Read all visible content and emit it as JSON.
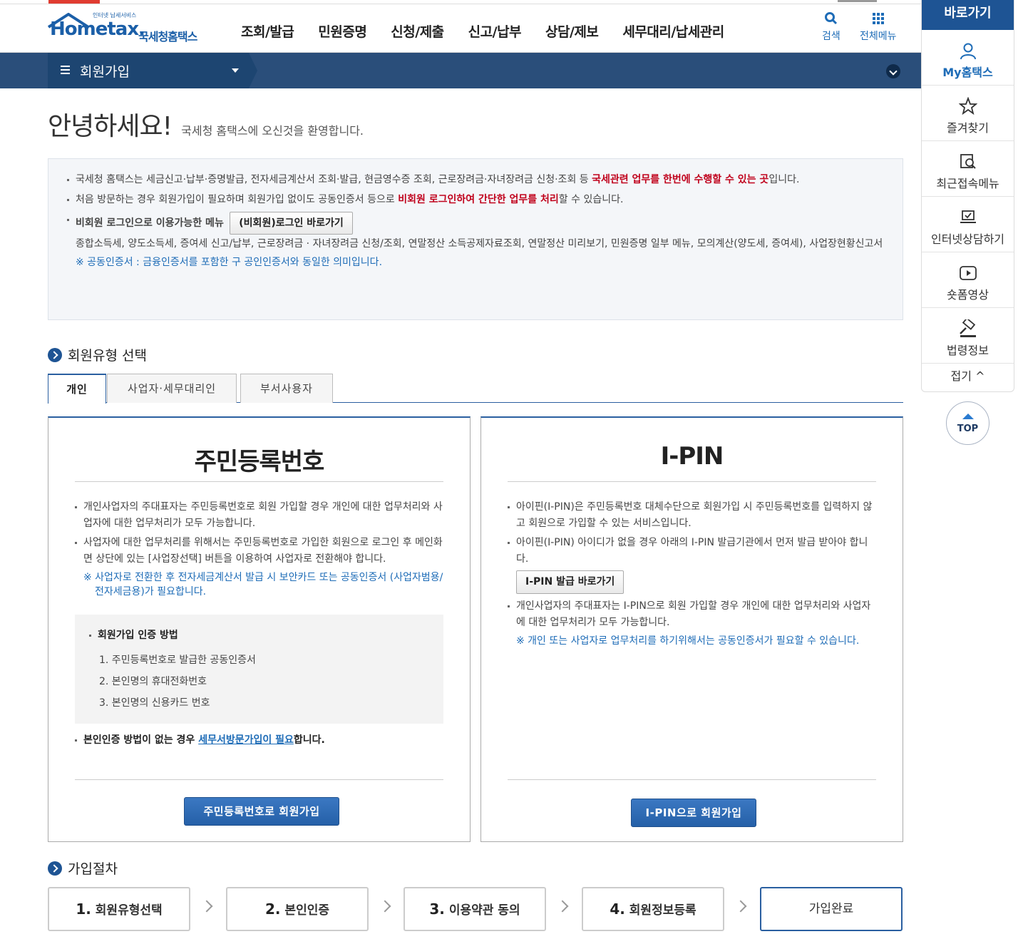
{
  "header": {
    "logo_small": "인터넷 납세서비스",
    "logo_main": "Hometax.",
    "logo_kor": "국세청홈택스",
    "nav": [
      "조회/발급",
      "민원증명",
      "신청/제출",
      "신고/납부",
      "상담/제보",
      "세무대리/납세관리"
    ],
    "search_label": "검색",
    "allmenu_label": "전체메뉴"
  },
  "subbar": {
    "current": "회원가입"
  },
  "quick": {
    "title": "바로가기",
    "items": [
      "My홈택스",
      "즐겨찾기",
      "최근접속메뉴",
      "인터넷상담하기",
      "숏폼영상",
      "법령정보"
    ],
    "fold": "접기",
    "top": "TOP"
  },
  "greeting": {
    "big": "안녕하세요!",
    "small": "국세청 홈택스에 오신것을 환영합니다."
  },
  "info": {
    "line1_a": "국세청 홈택스는 세금신고·납부·증명발급, 전자세금계산서 조회·발급, 현금영수증 조회, 근로장려금·자녀장려금 신청·조회 등 ",
    "line1_red": "국세관련 업무를 한번에 수행할 수 있는 곳",
    "line1_b": "입니다.",
    "line2_a": "처음 방문하는 경우 회원가입이 필요하며 회원가입 없이도 공동인증서 등으로 ",
    "line2_red": "비회원 로그인하여 간단한 업무를 처리",
    "line2_b": "할 수 있습니다.",
    "line3_label": "비회원 로그인으로 이용가능한 메뉴",
    "line3_button": "(비회원)로그인 바로가기",
    "line3_menus": "종합소득세, 양도소득세, 증여세 신고/납부, 근로장려금 · 자녀장려금 신청/조회, 연말정산 소득공제자료조회, 연말정산 미리보기, 민원증명 일부 메뉴, 모의계산(양도세, 증여세), 사업장현황신고서",
    "note": "※ 공동인증서 : 금융인증서를 포함한 구 공인인증서와 동일한 의미입니다."
  },
  "member_type": {
    "title": "회원유형 선택",
    "tabs": [
      "개인",
      "사업자·세무대리인",
      "부서사용자"
    ]
  },
  "card_rrn": {
    "title": "주민등록번호",
    "li1": "개인사업자의 주대표자는 주민등록번호로 회원 가입할 경우 개인에 대한 업무처리와 사업자에 대한 업무처리가 모두 가능합니다.",
    "li2": "사업자에 대한 업무처리를 위해서는 주민등록번호로 가입한 회원으로 로그인 후 메인화면 상단에 있는 [사업장선택] 버튼을 이용하여 사업자로 전환해야 합니다.",
    "note": "※ 사업자로 전환한 후 전자세금계산서 발급 시 보안카드 또는 공동인증서 (사업자범용/전자세금용)가 필요합니다.",
    "auth_title": "회원가입 인증 방법",
    "auth_1": "1. 주민등록번호로 발급한 공동인증서",
    "auth_2": "2. 본인명의 휴대전화번호",
    "auth_3": "3. 본인명의 신용카드 번호",
    "visit_a": "본인인증 방법이 없는 경우 ",
    "visit_link": "세무서방문가입이 필요",
    "visit_b": "합니다.",
    "button": "주민등록번호로 회원가입"
  },
  "card_ipin": {
    "title": "I-PIN",
    "li1": "아이핀(I-PIN)은 주민등록번호 대체수단으로 회원가입 시 주민등록번호를 입력하지 않고 회원으로 가입할 수 있는 서비스입니다.",
    "li2": "아이핀(I-PIN) 아이디가 없을 경우 아래의 I-PIN 발급기관에서 먼저 발급 받아야 합니다.",
    "issue_button": "I-PIN 발급 바로가기",
    "li3": "개인사업자의 주대표자는 I-PIN으로 회원 가입할 경우 개인에 대한 업무처리와 사업자에 대한 업무처리가 모두 가능합니다.",
    "note": "※ 개인 또는 사업자로 업무처리를 하기위해서는 공동인증서가 필요할 수 있습니다.",
    "button": "I-PIN으로 회원가입"
  },
  "procedure": {
    "title": "가입절차",
    "steps": [
      {
        "num": "1.",
        "label": " 회원유형선택"
      },
      {
        "num": "2.",
        "label": " 본인인증"
      },
      {
        "num": "3.",
        "label": " 이용약관 동의"
      },
      {
        "num": "4.",
        "label": " 회원정보등록"
      },
      {
        "num": "",
        "label": "가입완료"
      }
    ]
  },
  "colors": {
    "primary": "#1e5494",
    "accent_red": "#c0021c",
    "link_blue": "#1e6cb7"
  }
}
